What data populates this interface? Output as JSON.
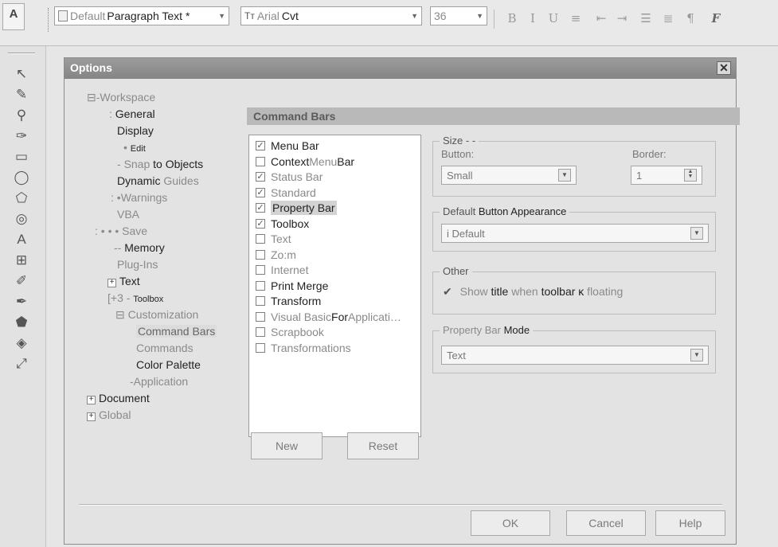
{
  "propbar": {
    "corner_tool": "A",
    "style_combo": {
      "prefix": "Default",
      "value": "Paragraph Text *"
    },
    "font_combo": {
      "icon": "Tт",
      "prefix": "Arial",
      "value": "Cvt"
    },
    "size_combo": {
      "value": "36"
    },
    "buttons": [
      {
        "name": "bold-icon",
        "glyph": "B"
      },
      {
        "name": "italic-icon",
        "glyph": "I"
      },
      {
        "name": "underline-icon",
        "glyph": "U"
      },
      {
        "name": "align-icon",
        "glyph": "≡"
      },
      {
        "name": "indent-decrease-icon",
        "glyph": "⇤"
      },
      {
        "name": "indent-increase-icon",
        "glyph": "⇥"
      },
      {
        "name": "bullets-icon",
        "glyph": "☰"
      },
      {
        "name": "dropcap-icon",
        "glyph": "≣"
      },
      {
        "name": "paragraph-icon",
        "glyph": "¶"
      },
      {
        "name": "font-format-icon",
        "glyph": "F"
      }
    ]
  },
  "toolbox": [
    "pick-tool-icon",
    "shape-tool-icon",
    "zoom-tool-icon",
    "freehand-tool-icon",
    "rectangle-tool-icon",
    "ellipse-tool-icon",
    "polygon-tool-icon",
    "spiral-tool-icon",
    "text-tool-icon",
    "interactive-tool-icon",
    "eyedropper-tool-icon",
    "outline-tool-icon",
    "fill-tool-icon",
    "interactive-fill-icon",
    "mesh-fill-icon"
  ],
  "dialog": {
    "title": "Options",
    "close": "✕",
    "tree": [
      {
        "label": "Workspace",
        "prefix": "⊟-",
        "dim": true
      },
      {
        "label": "General",
        "prefix": ":  "
      },
      {
        "label": "Display",
        "prefix": ""
      },
      {
        "label": "Edit",
        "prefix": "• "
      },
      {
        "label_a": "Snap",
        "label_b": " to Objects",
        "prefix": "- "
      },
      {
        "label_a": "Dynamic",
        "label_b": " Guides",
        "prefix": ""
      },
      {
        "label": "Warnings",
        "prefix": ": •",
        "dim": true
      },
      {
        "label": "VBA",
        "prefix": "",
        "dim": true
      },
      {
        "label": "Save",
        "prefix": ": • • • ",
        "dim": true
      },
      {
        "label": "Memory",
        "prefix": "-- "
      },
      {
        "label": "Plug-Ins",
        "prefix": "",
        "dim": true
      },
      {
        "label": "Text",
        "prefix": "+"
      },
      {
        "label": "Toolbox",
        "prefix": "[+3 - "
      },
      {
        "label": "Customization",
        "prefix": "⊟ ",
        "dim": true
      },
      {
        "label": "Command Bars",
        "prefix": "",
        "selected": true
      },
      {
        "label": "Commands",
        "prefix": "",
        "dim": true
      },
      {
        "label": "Color Palette",
        "prefix": ""
      },
      {
        "label": "Application",
        "prefix": "-",
        "dim": true
      },
      {
        "label": "Document",
        "prefix": "+"
      },
      {
        "label": "Global",
        "prefix": "+",
        "dim": true
      }
    ],
    "panel_header": "Command Bars",
    "command_bars": [
      {
        "label": "Menu Bar",
        "checked": true
      },
      {
        "label_a": "Context",
        "label_b": " Menu",
        "label_c": " Bar",
        "checked": false
      },
      {
        "label": "Status Bar",
        "checked": true,
        "dim": true
      },
      {
        "label": "Standard",
        "checked": true,
        "dim": true
      },
      {
        "label": "Property Bar",
        "checked": true,
        "highlight": true
      },
      {
        "label": "Toolbox",
        "checked": true
      },
      {
        "label": "Text",
        "checked": false,
        "dim": true
      },
      {
        "label": "Zo:m",
        "checked": false,
        "dim": true
      },
      {
        "label": "Internet",
        "checked": false,
        "dim": true
      },
      {
        "label": "Print Merge",
        "checked": false
      },
      {
        "label": "Transform",
        "checked": false
      },
      {
        "label_a": "Visual Basic",
        "label_b": " For",
        "label_c": " Applicati…",
        "checked": false
      },
      {
        "label": "Scrapbook",
        "checked": false,
        "dim": true
      },
      {
        "label": "Transformations",
        "checked": false,
        "dim": true
      }
    ],
    "new_button": "New",
    "reset_button": "Reset",
    "size_group": {
      "legend": "Size - -",
      "button_label": "Button:",
      "button_value": "Small",
      "border_label": "Border:",
      "border_value": "1"
    },
    "appearance_group": {
      "legend_a": "Default",
      "legend_b": " Button  Appearance",
      "value": "i Default"
    },
    "other_group": {
      "legend": "Other",
      "checkbox_a": "Show",
      "checkbox_b": " title",
      "checkbox_c": " when",
      "checkbox_d": " toolbar ĸ",
      "checkbox_e": " floating",
      "checked": true
    },
    "mode_group": {
      "legend_a": "Property Bar",
      "legend_b": " Mode",
      "value": "Text"
    },
    "ok_button": "OK",
    "cancel_button": "Cancel",
    "help_button": "Help"
  }
}
